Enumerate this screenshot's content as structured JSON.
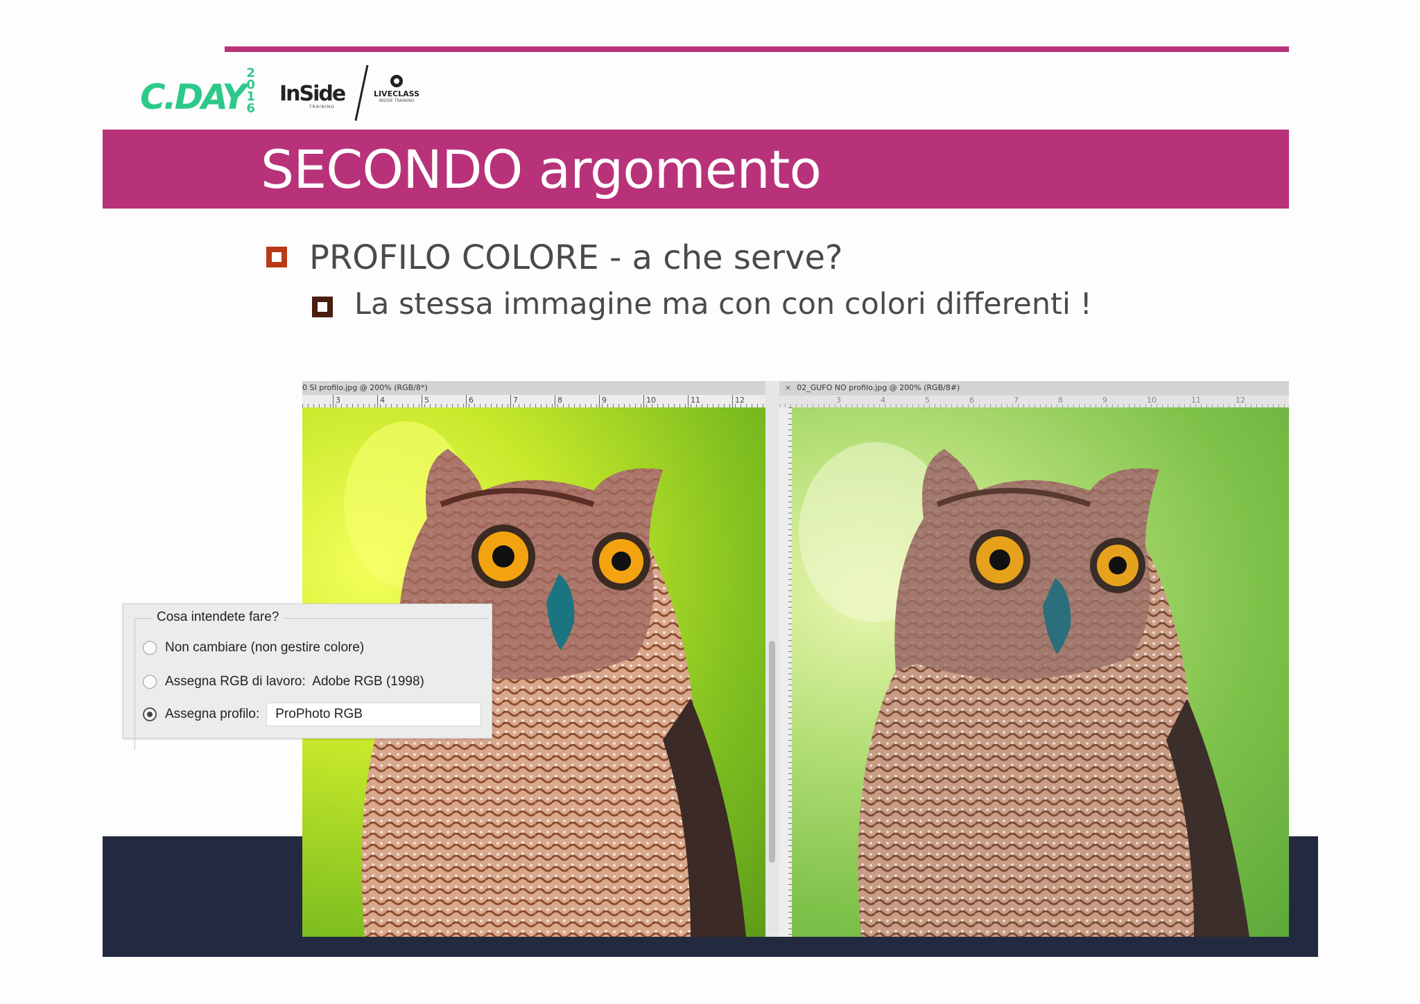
{
  "header": {
    "logos": {
      "cday": {
        "text": "C.DAY",
        "year": "20 16"
      },
      "inside": {
        "text": "InSide",
        "sub": "TRAINING"
      },
      "liveclass": {
        "name": "LIVECLASS",
        "sub": "INSIDE TRAINING"
      }
    },
    "title": "SECONDO argomento",
    "accent_color": "#b8327a"
  },
  "bullets": [
    {
      "level": 1,
      "text": "PROFILO COLORE - a che serve?",
      "marker_color": "#b83a16"
    },
    {
      "level": 2,
      "text": "La stessa immagine ma con con colori differenti !",
      "marker_color": "#4a1d10"
    }
  ],
  "ps_left": {
    "tab_title": "0 SI profilo.jpg @ 200% (RGB/8*)",
    "ruler_numbers": [
      "3",
      "4",
      "5",
      "6",
      "7",
      "8",
      "9",
      "10",
      "11",
      "12"
    ]
  },
  "ps_right": {
    "tab_close": "×",
    "tab_title": "02_GUFO NO profilo.jpg @ 200% (RGB/8#)",
    "ruler_numbers": [
      "3",
      "4",
      "5",
      "6",
      "7",
      "8",
      "9",
      "10",
      "11",
      "12"
    ]
  },
  "dialog": {
    "title": "Cosa intendete fare?",
    "options": [
      {
        "label": "Non cambiare (non gestire colore)",
        "checked": false
      },
      {
        "label": "Assegna RGB di lavoro:  Adobe RGB (1998)",
        "checked": false
      },
      {
        "label": "Assegna profilo:",
        "checked": true
      }
    ],
    "profile_value": "ProPhoto RGB"
  },
  "colors": {
    "bottom_band": "#232a40",
    "title_bar": "#b8327a"
  }
}
